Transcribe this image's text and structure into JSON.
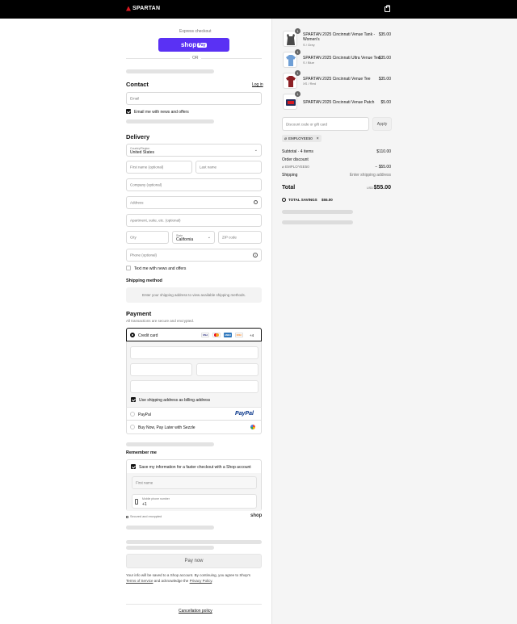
{
  "header": {
    "brand": "SPARTAN"
  },
  "express": {
    "title": "Express checkout",
    "button_label": "shop",
    "button_badge": "Pay",
    "or": "OR"
  },
  "contact": {
    "heading": "Contact",
    "login_link": "Log in",
    "email_placeholder": "Email",
    "news_label": "Email me with news and offers"
  },
  "delivery": {
    "heading": "Delivery",
    "country_label": "Country/Region",
    "country_value": "United States",
    "first_name": "First name (optional)",
    "last_name": "Last name",
    "company": "Company (optional)",
    "address": "Address",
    "apartment": "Apartment, suite, etc. (optional)",
    "city": "City",
    "state_label": "State",
    "state_value": "California",
    "zip": "ZIP code",
    "phone": "Phone (optional)",
    "text_label": "Text me with news and offers"
  },
  "shipping": {
    "heading": "Shipping method",
    "notice": "Enter your shipping address to view available shipping methods."
  },
  "payment": {
    "heading": "Payment",
    "subtitle": "All transactions are secure and encrypted.",
    "credit_card": "Credit card",
    "more_cards": "+4",
    "cards": [
      "VISA",
      "MC",
      "AMEX",
      "DISC"
    ],
    "billing_label": "Use shipping address as billing address",
    "paypal": "PayPal",
    "paypal_logo": "PayPal",
    "sezzle": "Buy Now, Pay Later with Sezzle"
  },
  "remember": {
    "heading": "Remember me",
    "save_label": "Save my information for a faster checkout with a Shop account",
    "first_name": "First name",
    "phone_label": "Mobile phone number",
    "phone_value": "+1",
    "secure": "Secured and encrypted",
    "shop_logo": "shop"
  },
  "pay_now": "Pay now",
  "legal": {
    "text_1": "Your info will be saved to a Shop account. By continuing, you agree to Shop's",
    "terms": "Terms of Service",
    "text_2": "and acknowledge the",
    "privacy": "Privacy Policy",
    "period": "."
  },
  "footer": {
    "cancellation": "Cancellation policy"
  },
  "order": {
    "items": [
      {
        "title_1": "SPARTAN 2025 Cincinnati Venue Tank -",
        "title_2": "Women's",
        "variant": "S / Grey",
        "price": "$35.00",
        "qty": "1"
      },
      {
        "title_1": "SPARTAN 2025 Cincinnati Ultra Venue Tee",
        "title_2": "",
        "variant": "S / Blue",
        "price": "$35.00",
        "qty": "1"
      },
      {
        "title_1": "SPARTAN 2025 Cincinnati Venue Tee",
        "title_2": "",
        "variant": "XS / Red",
        "price": "$35.00",
        "qty": "1"
      },
      {
        "title_1": "SPARTAN 2025 Cincinnati Venue Patch",
        "title_2": "",
        "variant": "",
        "price": "$5.00",
        "qty": "1"
      }
    ],
    "discount_placeholder": "Discount code or gift card",
    "apply": "Apply",
    "code": "EMPLOYEE50",
    "subtotal_label": "Subtotal · 4 items",
    "subtotal_value": "$110.00",
    "order_discount_label": "Order discount",
    "order_discount_code": "EMPLOYEE50",
    "order_discount_value": "− $55.00",
    "shipping_label": "Shipping",
    "shipping_value": "Enter shipping address",
    "total_label": "Total",
    "currency": "USD",
    "total_value": "$55.00",
    "savings_label": "TOTAL SAVINGS",
    "savings_value": "$55.00"
  },
  "colors": {
    "shop_purple": "#5a31f4",
    "paypal_blue": "#003087",
    "tank_grey": "#4a4a4a",
    "tee_blue": "#6f9fd6",
    "tee_red": "#8c1f24"
  }
}
